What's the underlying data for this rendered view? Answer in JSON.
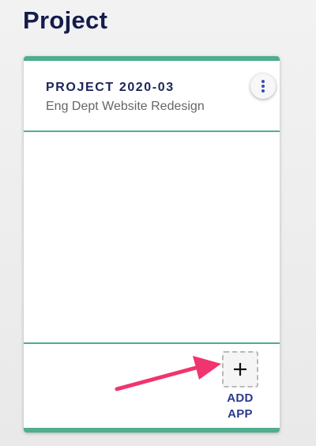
{
  "page": {
    "title": "Project"
  },
  "card": {
    "project_code": "PROJECT 2020-03",
    "project_name": "Eng Dept Website Redesign",
    "menu_icon": "more-vertical-icon",
    "add_app": {
      "icon": "plus-icon",
      "label_line1": "ADD",
      "label_line2": "APP"
    }
  },
  "annotation": {
    "arrow_color": "#f0346e"
  },
  "colors": {
    "accent_green": "#4fae8d",
    "title_navy": "#141c4d",
    "link_blue": "#2a3a8f"
  }
}
